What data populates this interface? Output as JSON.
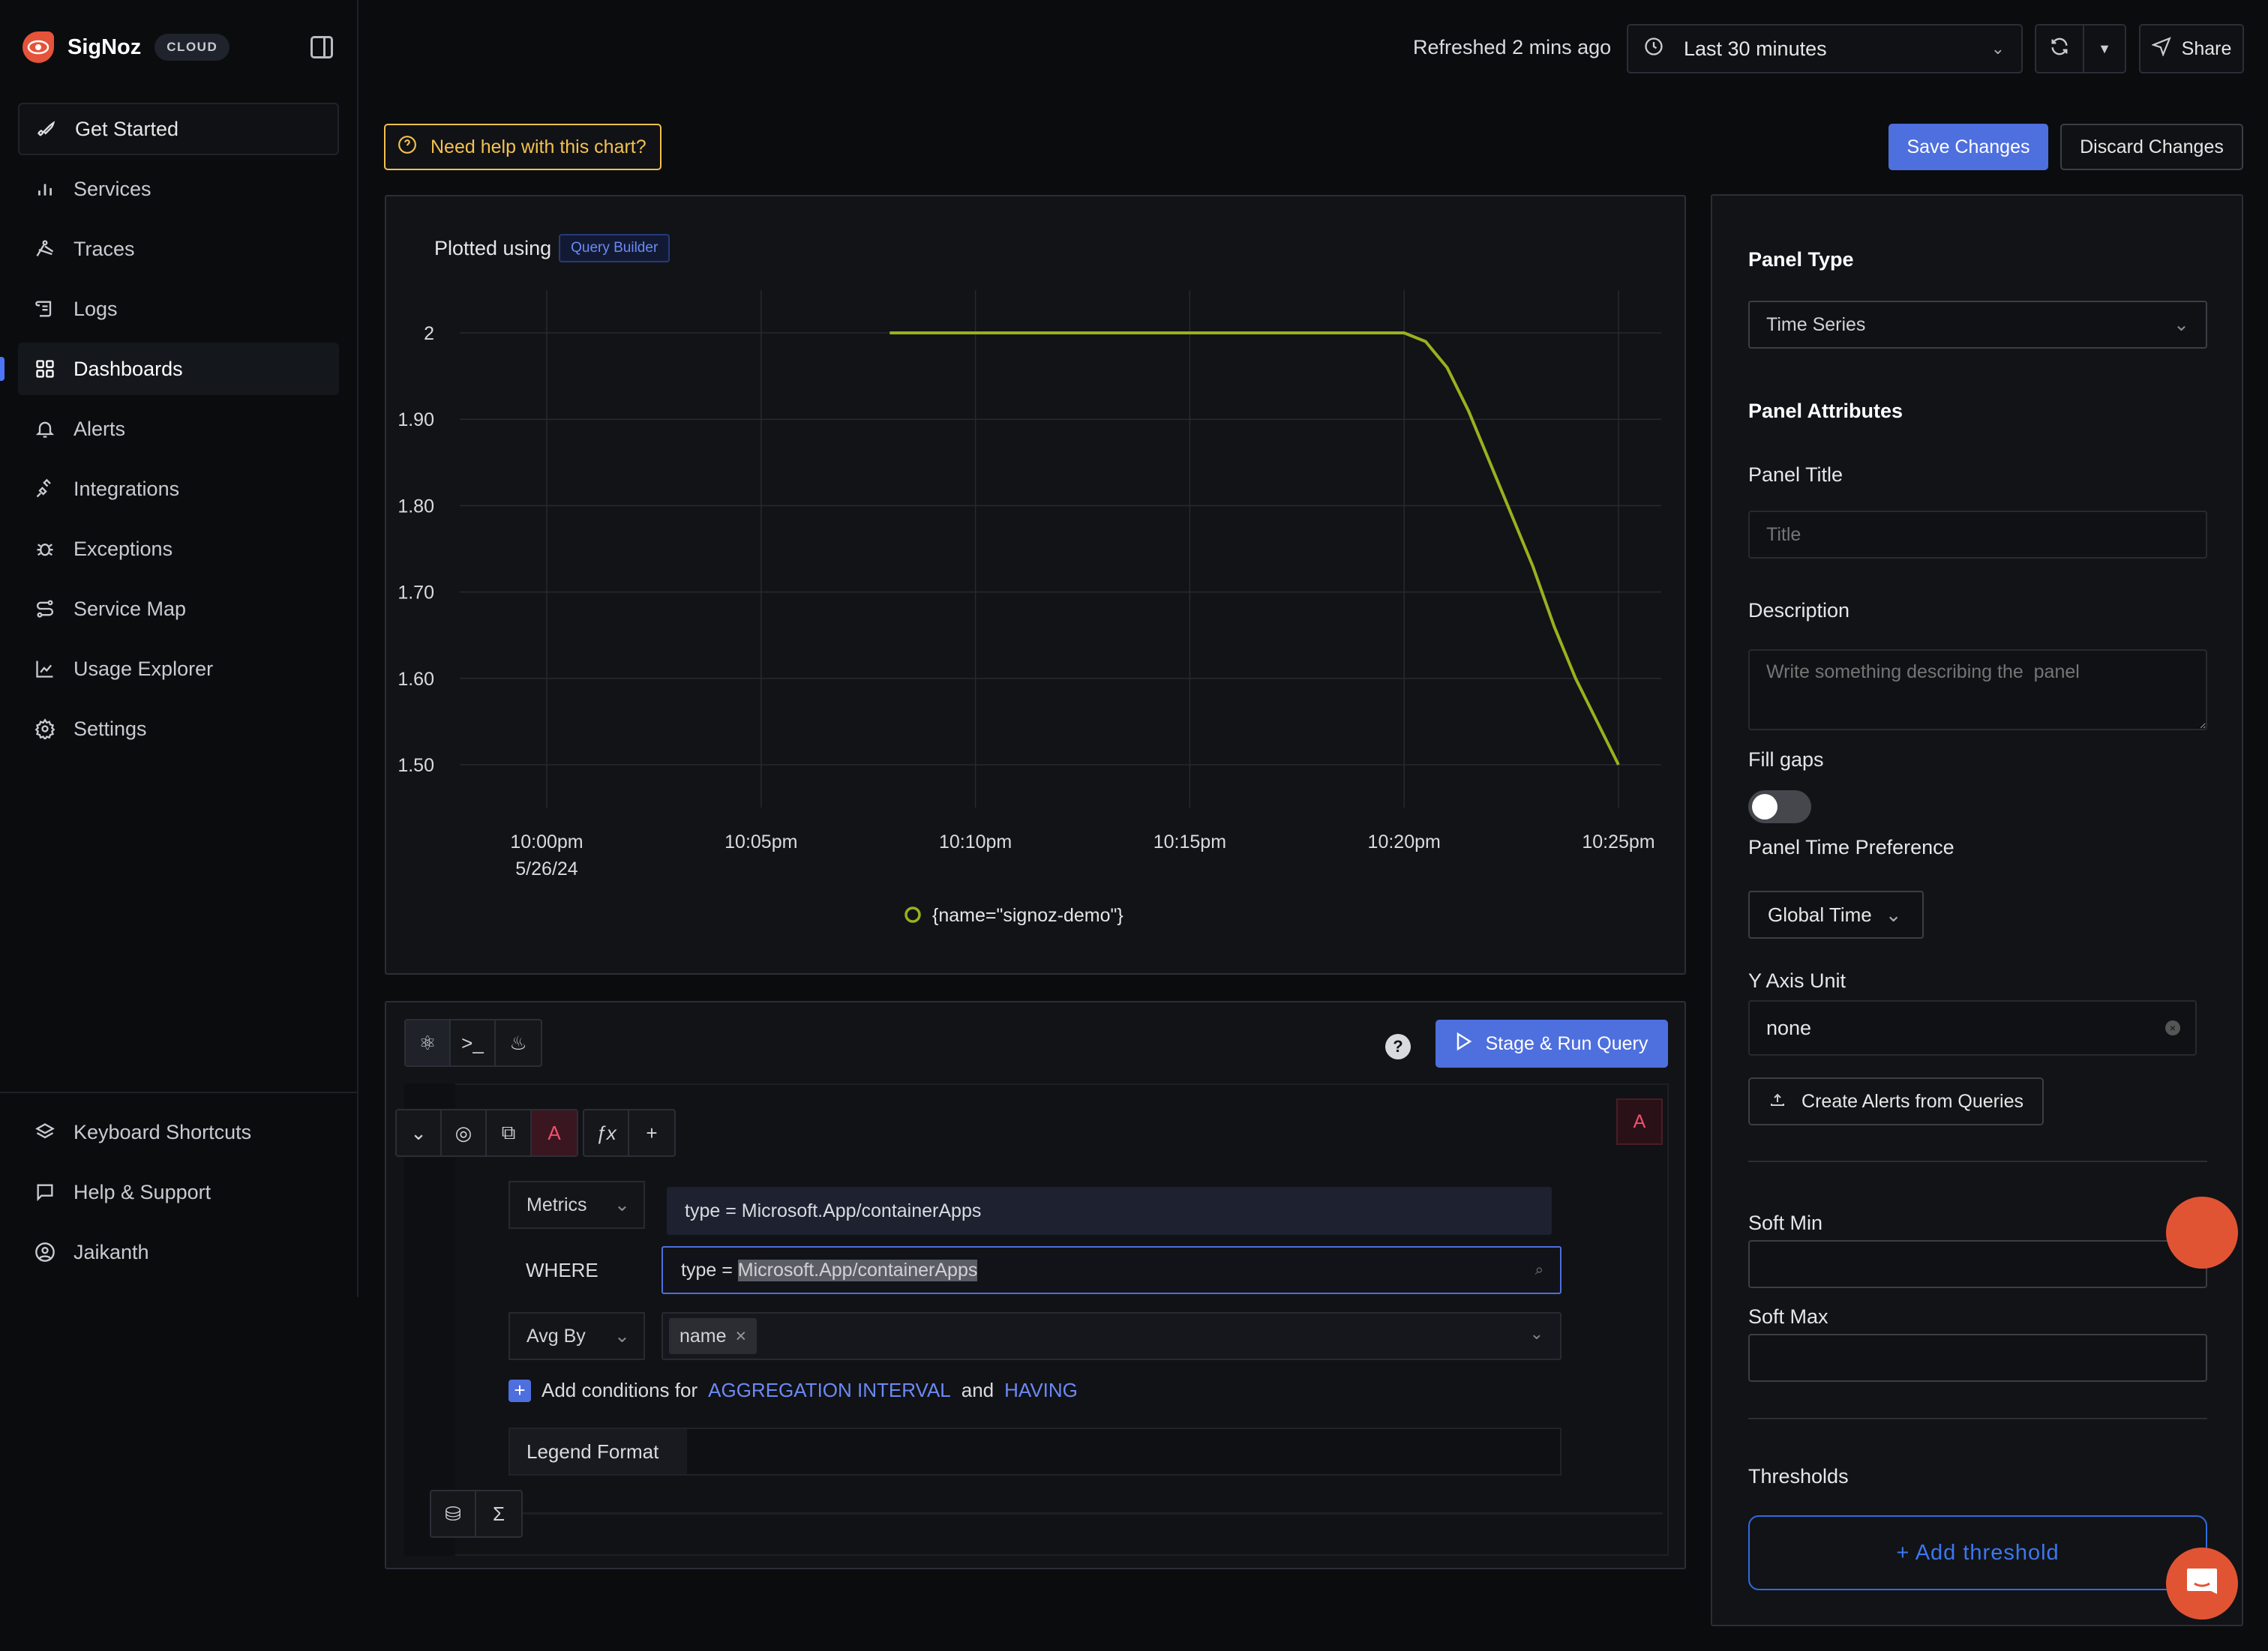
{
  "app": {
    "name": "SigNoz",
    "badge": "CLOUD"
  },
  "sidebar": {
    "items": [
      {
        "label": "Get Started",
        "icon": "rocket-icon"
      },
      {
        "label": "Services",
        "icon": "bar-chart-icon"
      },
      {
        "label": "Traces",
        "icon": "traces-icon"
      },
      {
        "label": "Logs",
        "icon": "scroll-icon"
      },
      {
        "label": "Dashboards",
        "icon": "grid-icon",
        "active": true
      },
      {
        "label": "Alerts",
        "icon": "bell-icon"
      },
      {
        "label": "Integrations",
        "icon": "plug-icon"
      },
      {
        "label": "Exceptions",
        "icon": "bug-icon"
      },
      {
        "label": "Service Map",
        "icon": "route-icon"
      },
      {
        "label": "Usage Explorer",
        "icon": "area-chart-icon"
      },
      {
        "label": "Settings",
        "icon": "gear-icon"
      }
    ],
    "bottom": [
      {
        "label": "Keyboard Shortcuts",
        "icon": "layers-icon"
      },
      {
        "label": "Help & Support",
        "icon": "message-icon"
      },
      {
        "label": "Jaikanth",
        "icon": "user-circle-icon"
      }
    ]
  },
  "topbar": {
    "refreshed": "Refreshed 2 mins ago",
    "time_range": "Last 30 minutes",
    "share": "Share"
  },
  "actions": {
    "help": "Need help with this chart?",
    "save": "Save Changes",
    "discard": "Discard Changes"
  },
  "chart_panel": {
    "plotted_using": "Plotted using",
    "builder": "Query Builder"
  },
  "chart_data": {
    "type": "line",
    "title": "",
    "xlabel": "",
    "ylabel": "",
    "x_ticks": [
      "10:00pm",
      "10:05pm",
      "10:10pm",
      "10:15pm",
      "10:20pm",
      "10:25pm"
    ],
    "x_tick_sub": "5/26/24",
    "x_range_min": [
      0,
      25
    ],
    "y_ticks": [
      "1.50",
      "1.60",
      "1.70",
      "1.80",
      "1.90",
      "2"
    ],
    "ylim": [
      1.45,
      2.05
    ],
    "grid": true,
    "legend_position": "bottom",
    "series": [
      {
        "name": "{name=\"signoz-demo\"}",
        "color": "#9bb01e",
        "x": [
          8,
          10,
          12,
          14,
          16,
          18,
          20,
          20.5,
          21,
          21.5,
          22,
          22.5,
          23,
          23.5,
          24,
          24.5,
          25
        ],
        "y": [
          2,
          2,
          2,
          2,
          2,
          2,
          2,
          1.99,
          1.96,
          1.91,
          1.85,
          1.79,
          1.73,
          1.66,
          1.6,
          1.55,
          1.5
        ]
      }
    ]
  },
  "query": {
    "stage_run": "Stage & Run Query",
    "query_name": "A",
    "data_source": "Metrics",
    "metric_value": "type = Microsoft.App/containerApps",
    "where_label": "WHERE",
    "where_prefix": "type = ",
    "where_selected": "Microsoft.App/containerApps",
    "agg_label": "Avg By",
    "group_tag": "name",
    "conditions_prefix": "Add conditions for",
    "agg_interval": "AGGREGATION INTERVAL",
    "and": "and",
    "having": "HAVING",
    "legend_format": "Legend Format"
  },
  "settings": {
    "panel_type_heading": "Panel Type",
    "panel_type": "Time Series",
    "attributes_heading": "Panel Attributes",
    "title_label": "Panel Title",
    "title_placeholder": "Title",
    "desc_label": "Description",
    "desc_placeholder": "Write something describing the  panel",
    "fill_gaps": "Fill gaps",
    "fill_gaps_on": false,
    "time_pref_label": "Panel Time Preference",
    "time_pref": "Global Time",
    "y_unit_label": "Y Axis Unit",
    "y_unit": "none",
    "create_alerts": "Create Alerts from Queries",
    "soft_min": "Soft Min",
    "soft_max": "Soft Max",
    "thresholds": "Thresholds",
    "add_threshold": "+ Add threshold"
  }
}
